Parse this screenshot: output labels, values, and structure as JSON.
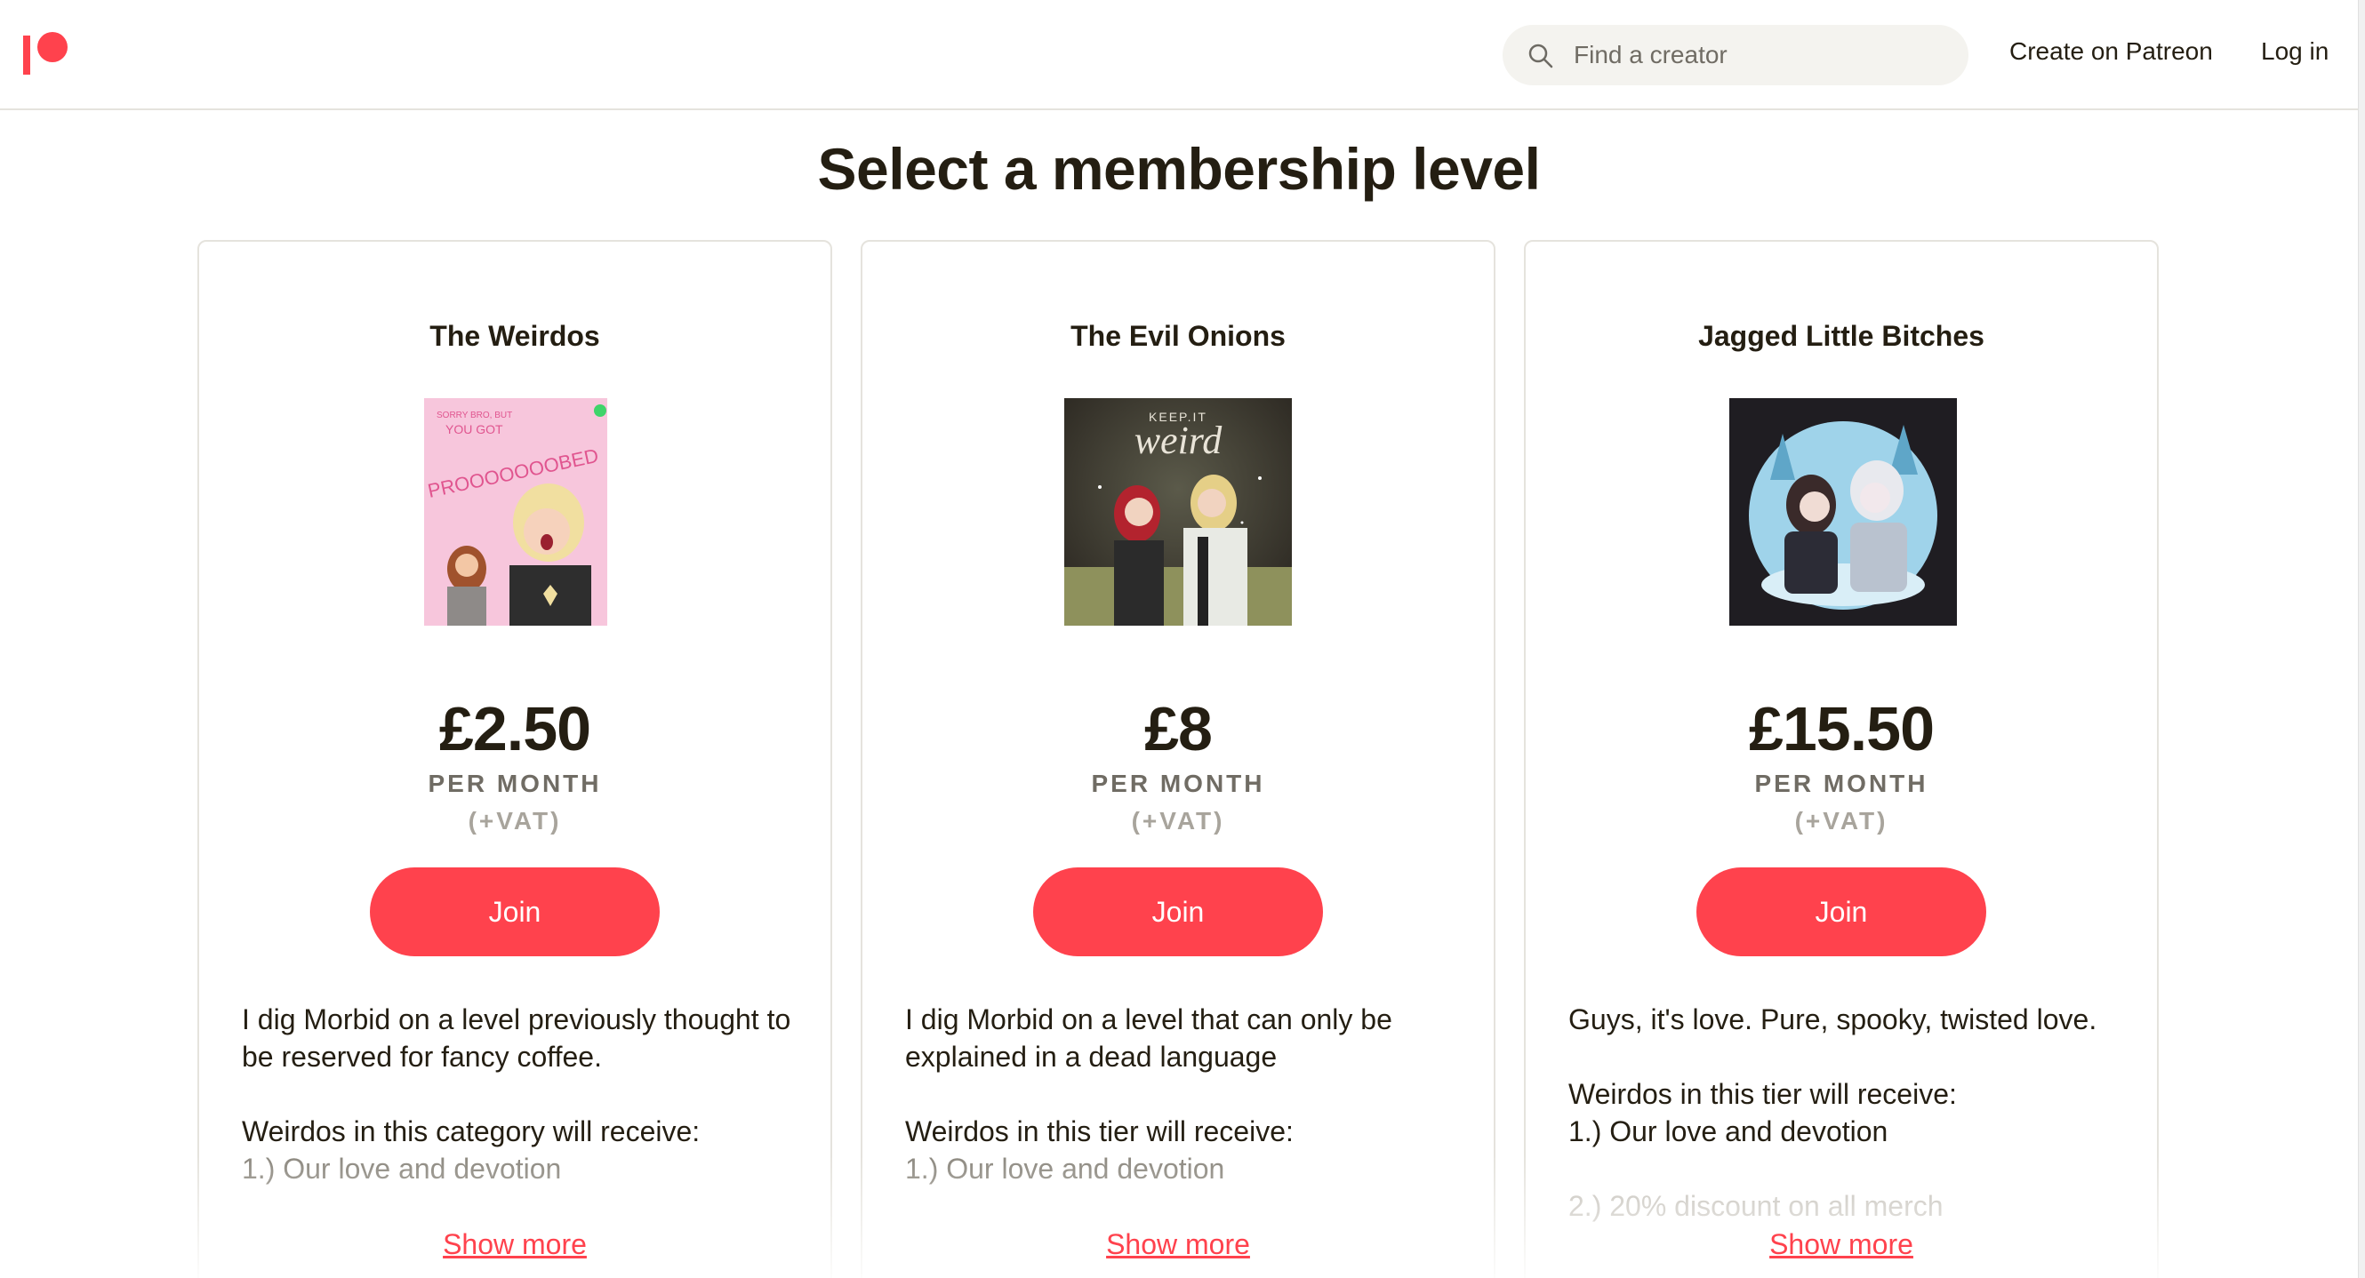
{
  "header": {
    "search_placeholder": "Find a creator",
    "create_link": "Create on Patreon",
    "login_link": "Log in"
  },
  "page_title": "Select a membership level",
  "tiers": [
    {
      "name": "The Weirdos",
      "image_text": [
        "SORRY BRO, BUT",
        "YOU GOT",
        "PROOOOOOOBED"
      ],
      "price": "£2.50",
      "period": "PER MONTH",
      "vat": "(+VAT)",
      "join_label": "Join",
      "description": [
        "I dig Morbid on a level previously thought to be reserved for fancy coffee.",
        "",
        "Weirdos in this category will receive:",
        "1.) Our love and devotion"
      ],
      "show_more": "Show more"
    },
    {
      "name": "The Evil Onions",
      "image_text": [
        "KEEP.IT",
        "weird"
      ],
      "price": "£8",
      "period": "PER MONTH",
      "vat": "(+VAT)",
      "join_label": "Join",
      "description": [
        "I dig Morbid on a level that can only be explained in a dead language",
        "",
        "Weirdos in this tier will receive:",
        "1.) Our love and devotion"
      ],
      "show_more": "Show more"
    },
    {
      "name": "Jagged Little Bitches",
      "price": "£15.50",
      "period": "PER MONTH",
      "vat": "(+VAT)",
      "join_label": "Join",
      "description": [
        "Guys, it's love. Pure, spooky, twisted love.",
        "",
        "Weirdos in this tier will receive:",
        "1.) Our love and devotion",
        "",
        "2.) 20% discount on all merch"
      ],
      "show_more": "Show more"
    }
  ],
  "colors": {
    "brand": "#ff424d",
    "text": "#241e12",
    "muted": "#706c64",
    "border": "#e5e3dd"
  }
}
